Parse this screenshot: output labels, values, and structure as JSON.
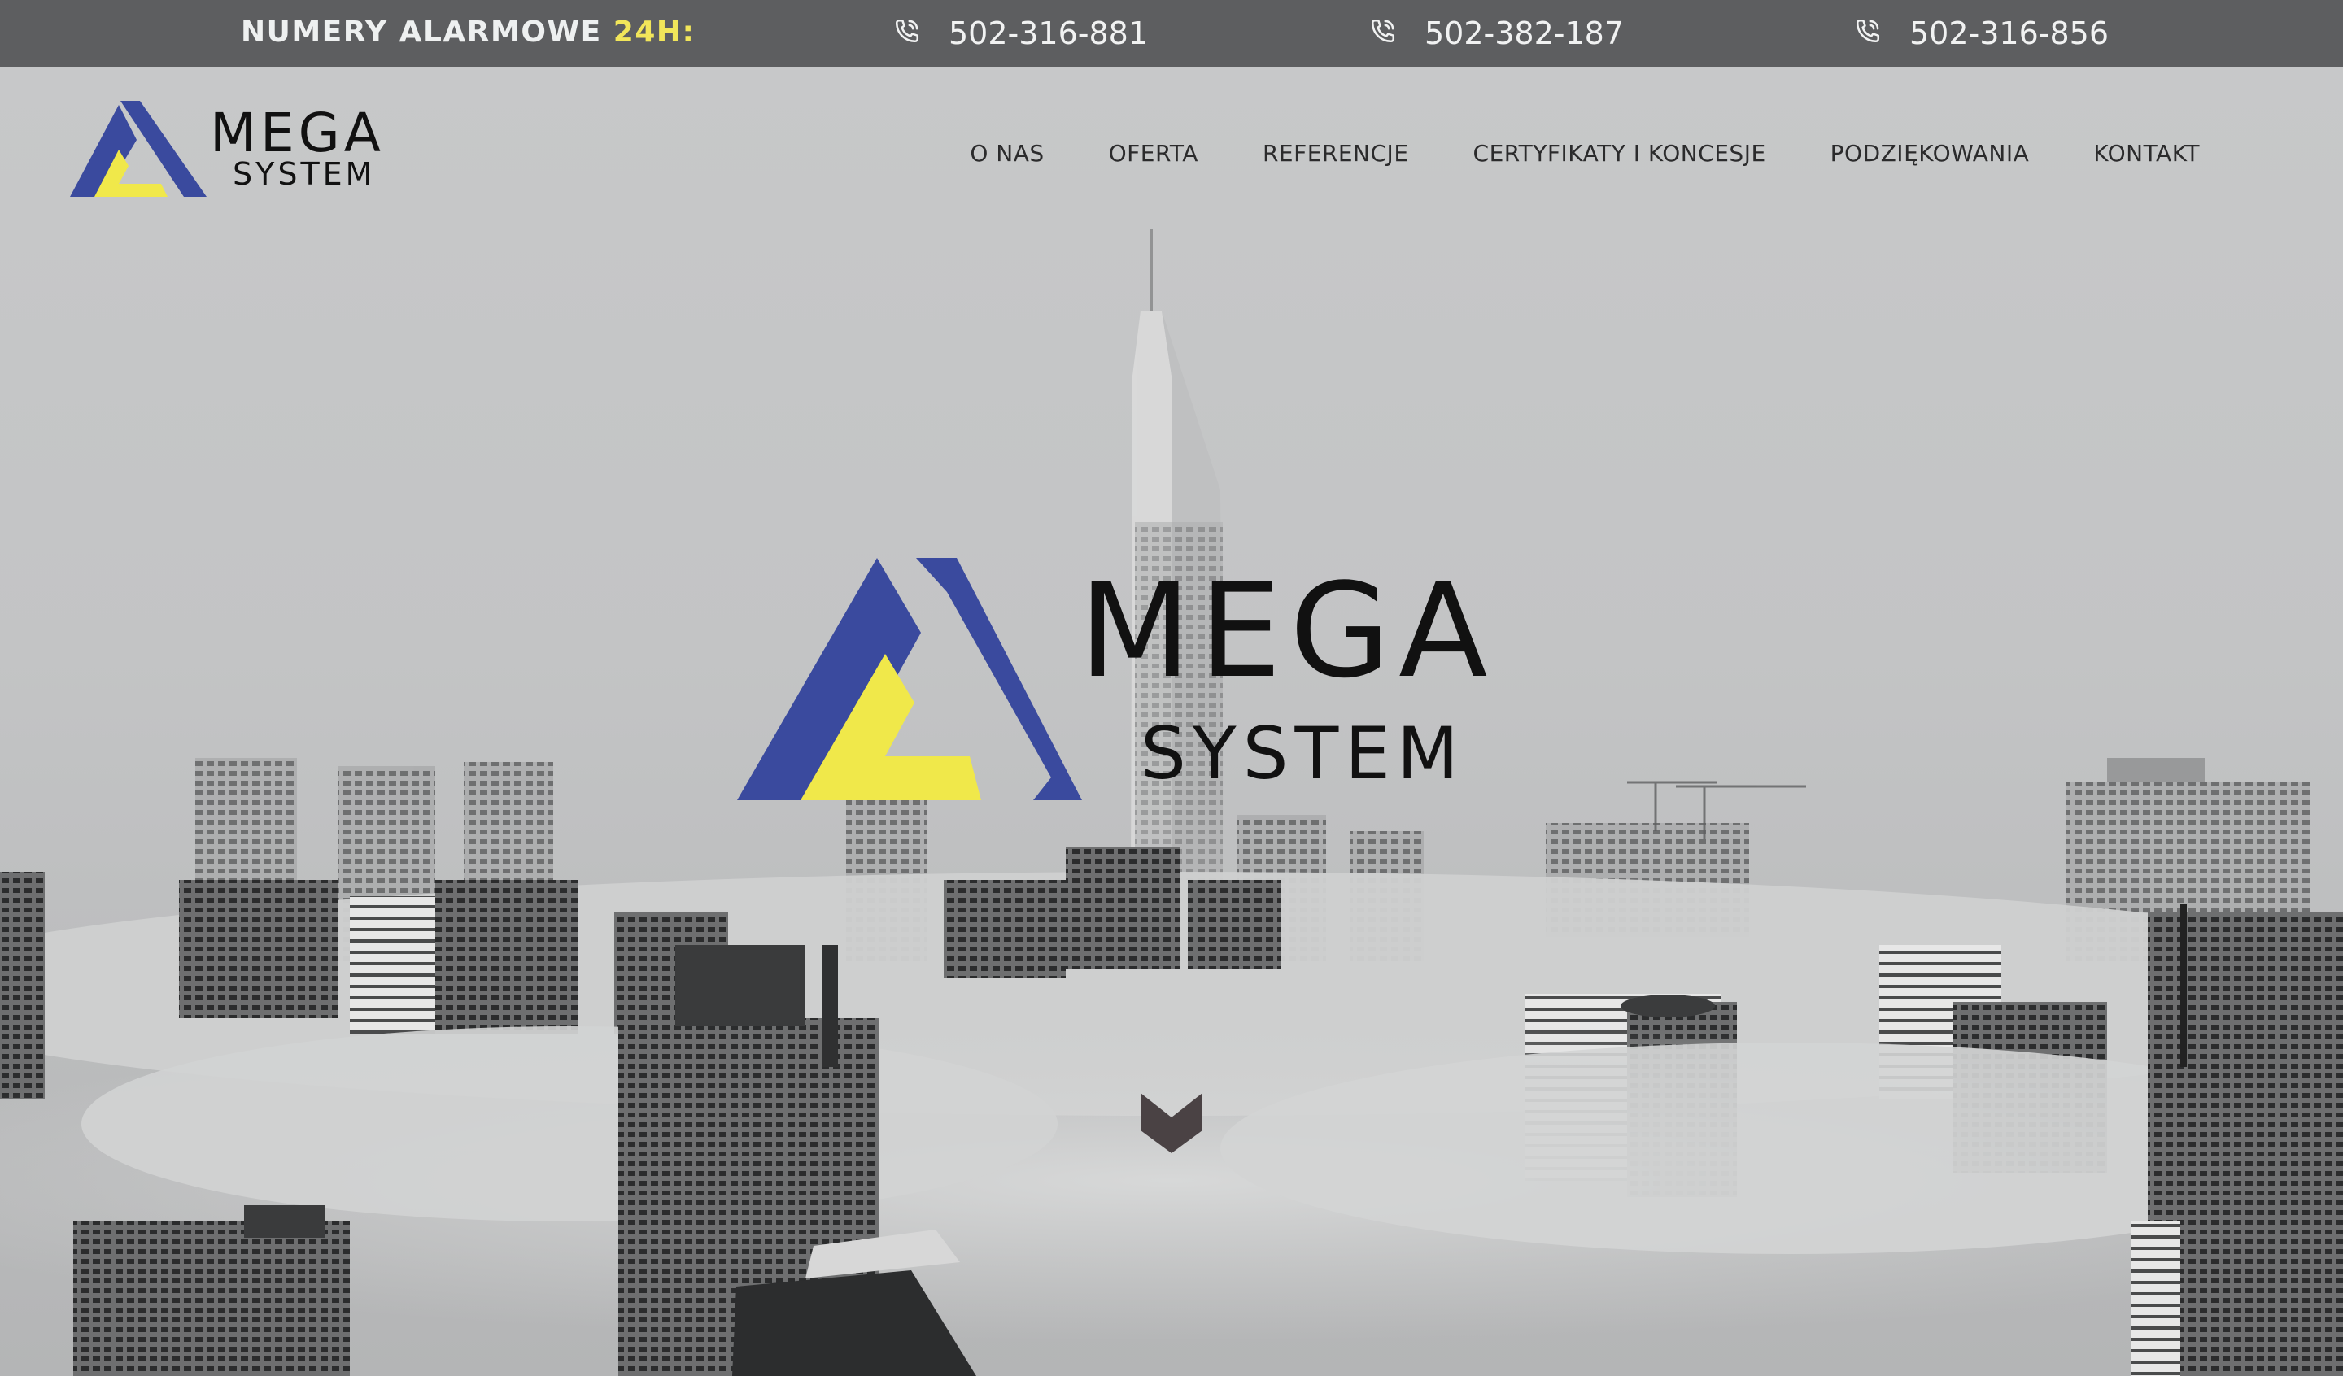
{
  "topbar": {
    "alarm_label": "NUMERY ALARMOWE",
    "alarm_highlight": "24H:",
    "phones": [
      "502-316-881",
      "502-382-187",
      "502-316-856"
    ]
  },
  "brand": {
    "name_line1": "MEGA",
    "name_line2": "SYSTEM",
    "colors": {
      "blue": "#3a4a9e",
      "yellow": "#f0e84a"
    }
  },
  "nav": {
    "items": [
      "O NAS",
      "OFERTA",
      "REFERENCJE",
      "CERTYFIKATY I KONCESJE",
      "PODZIĘKOWANIA",
      "KONTAKT"
    ]
  },
  "hero": {
    "background": "black-and-white city skyline above fog",
    "scroll_icon": "chevron-down-icon"
  }
}
